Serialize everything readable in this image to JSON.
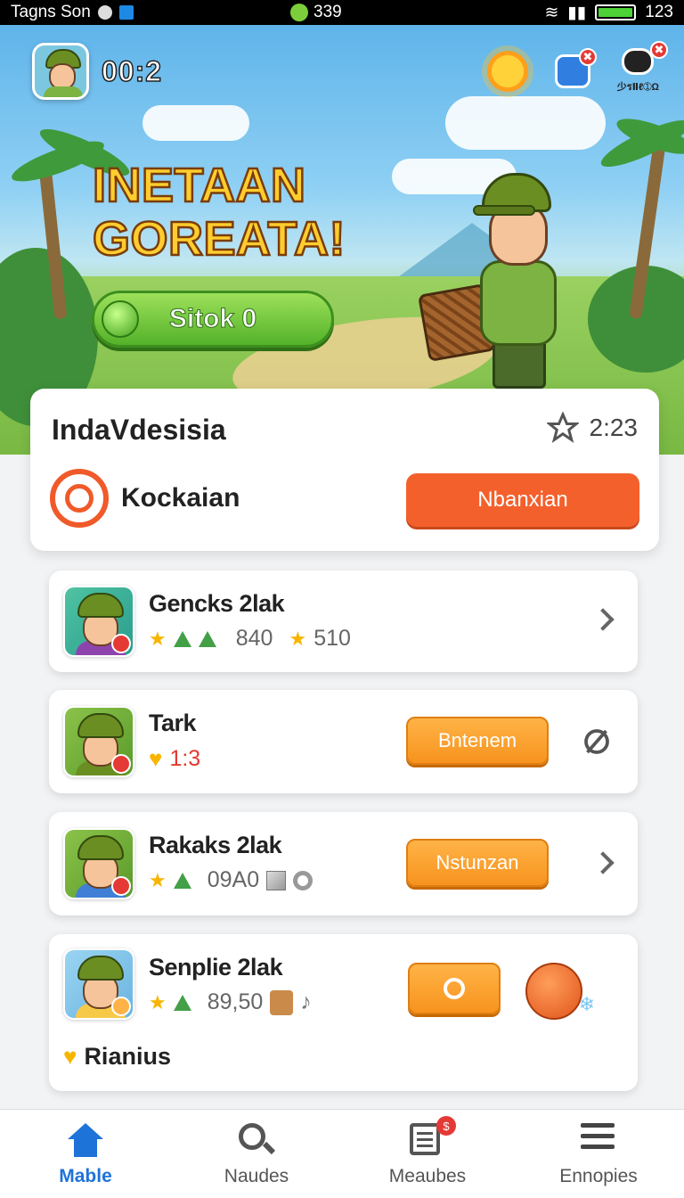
{
  "status_bar": {
    "app_name": "Tagns Son",
    "center_value": "339",
    "right_value": "123"
  },
  "hero": {
    "timer": "00:2",
    "camera_label": "少รⅡℓ➀Ω",
    "title_line1": "INETAAN",
    "title_line2": "GOREATA!",
    "start_button": "Sitok 0",
    "chat_badge": "✖",
    "camera_badge": "✖"
  },
  "main_card": {
    "title": "IndaVdesisia",
    "time": "2:23",
    "label": "Kockaian",
    "cta": "Nbanxian"
  },
  "items": [
    {
      "name": "Gencks 2lak",
      "value1": "840",
      "value2": "510"
    },
    {
      "name": "Tark",
      "value1": "1:3",
      "button": "Bntenem"
    },
    {
      "name": "Rakaks 2lak",
      "value1": "09A0",
      "button": "Nstunzan"
    },
    {
      "name": "Senplie 2lak",
      "value1": "89,50",
      "footer": "Rianius"
    }
  ],
  "bottom_nav": [
    {
      "label": "Mable"
    },
    {
      "label": "Naudes"
    },
    {
      "label": "Meaubes",
      "badge": "$"
    },
    {
      "label": "Ennopies"
    }
  ],
  "colors": {
    "accent": "#f4602c",
    "button_orange": "#f7931e",
    "nav_active": "#1e73d8",
    "start_green": "#53b229"
  }
}
